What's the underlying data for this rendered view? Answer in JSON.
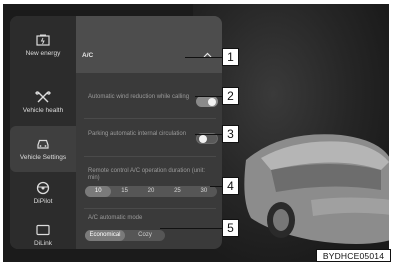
{
  "sidebar": {
    "items": [
      {
        "label": "New energy",
        "icon": "battery-icon"
      },
      {
        "label": "Vehicle health",
        "icon": "wrench-icon"
      },
      {
        "label": "Vehicle Settings",
        "icon": "car-front-icon"
      },
      {
        "label": "DiPilot",
        "icon": "steering-wheel-icon"
      },
      {
        "label": "DiLink",
        "icon": "screen-icon"
      }
    ],
    "active_index": 2
  },
  "ac": {
    "title": "A/C",
    "wind_reduction_label": "Automatic wind reduction while calling",
    "wind_reduction_on": true,
    "internal_circulation_label": "Parking automatic internal circulation",
    "internal_circulation_on": false,
    "duration_label": "Remote control A/C operation duration (unit: min)",
    "duration_options": [
      "10",
      "15",
      "20",
      "25",
      "30"
    ],
    "duration_selected": "10",
    "mode_label": "A/C automatic mode",
    "mode_options": [
      "Economical",
      "Cozy"
    ],
    "mode_selected": "Economical"
  },
  "callouts": [
    "1",
    "2",
    "3",
    "4",
    "5"
  ],
  "figure_code": "BYDHCE05014"
}
